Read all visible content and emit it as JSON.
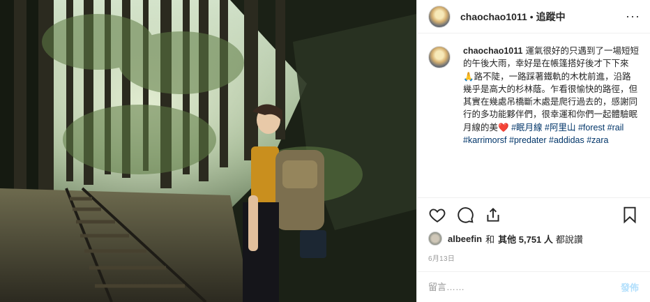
{
  "post": {
    "username": "chaochao1011",
    "dot": "•",
    "follow_status": "追蹤中",
    "more": "···"
  },
  "caption": {
    "username": "chaochao1011",
    "text": "運氣很好的只遇到了一場短短的午後大雨，幸好是在帳篷搭好後才下下來🙏路不陡，一路踩著鐵軌的木枕前進，沿路幾乎是高大的杉林蔭。乍看很愉快的路徑，但其實在幾處吊橋斷木處是爬行過去的，感謝同行的多功能夥伴們，很幸運和你們一起體驗眠月線的美",
    "heart": "❤️",
    "tags": [
      "#眠月線",
      "#阿里山",
      "#forest",
      "#rail",
      "#karrimorsf",
      "#predater",
      "#addidas",
      "#zara"
    ]
  },
  "likes": {
    "liker": "albeefin",
    "and": "和",
    "others": "其他 5,751 人",
    "rest": "都說讚"
  },
  "date": "6月13日",
  "comment_box": {
    "placeholder": "留言……",
    "post_label": "發佈"
  },
  "colors": {
    "link": "#003569",
    "post_disabled": "#b2dffc"
  },
  "icons": [
    "heart-icon",
    "comment-icon",
    "share-icon",
    "bookmark-icon",
    "more-icon"
  ]
}
